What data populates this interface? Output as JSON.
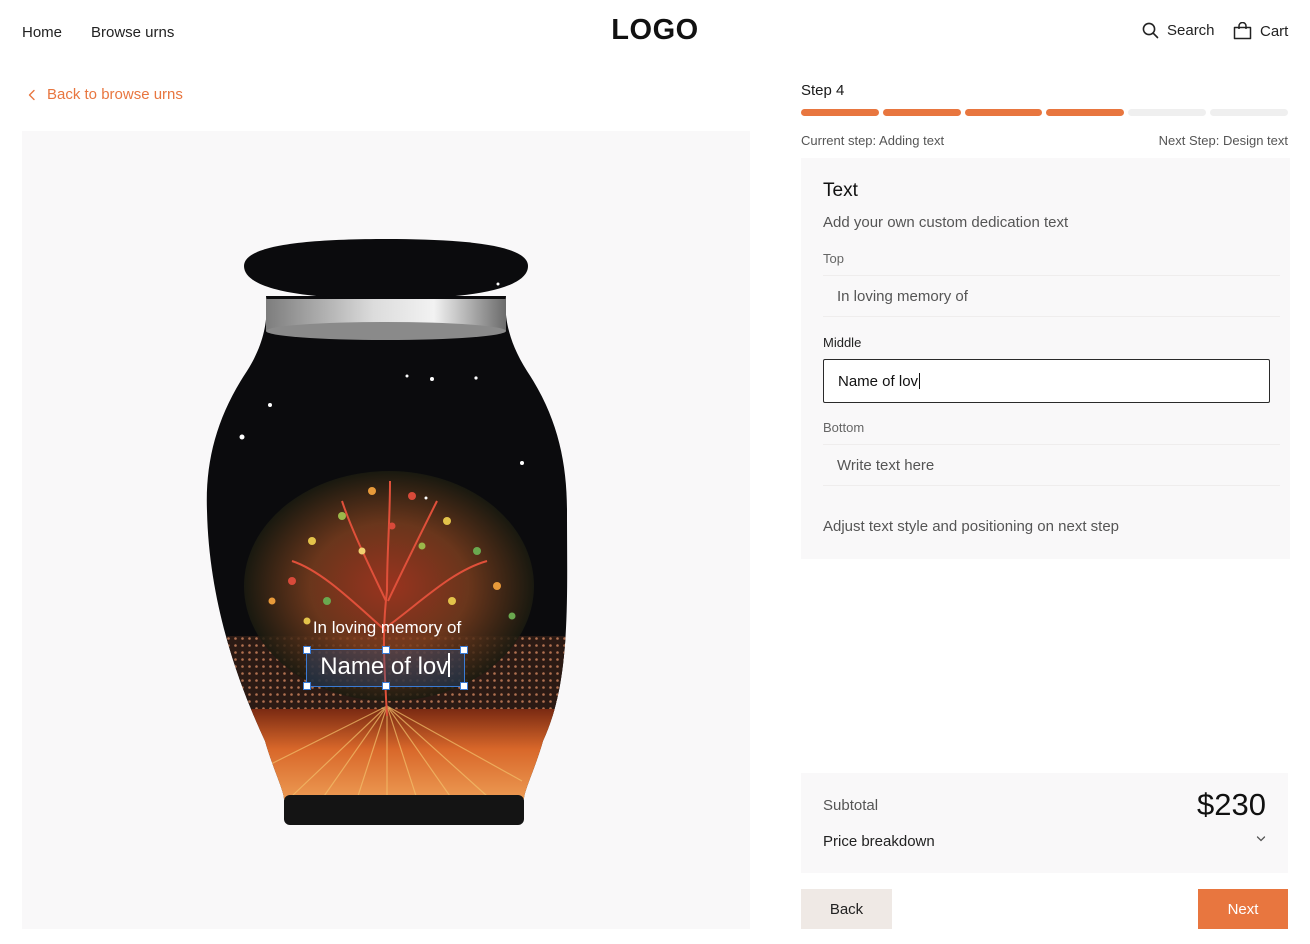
{
  "header": {
    "nav": [
      "Home",
      "Browse urns"
    ],
    "logo": "LOGO",
    "search_label": "Search",
    "search_icon": "search-icon",
    "cart_label": "Cart",
    "cart_icon": "shopping-bag-icon"
  },
  "back_link": {
    "label": "Back to browse urns",
    "icon": "chevron-left-icon"
  },
  "preview": {
    "top_text": "In loving memory of",
    "middle_text": "Name of lov"
  },
  "steps": {
    "label": "Step 4",
    "completed": 4,
    "total": 6,
    "current": "Current step: Adding text",
    "next": "Next Step: Design text"
  },
  "form": {
    "title": "Text",
    "subtitle": "Add your own custom dedication text",
    "top_label": "Top",
    "top_value": "In loving memory of",
    "middle_label": "Middle",
    "middle_value": "Name of lov",
    "bottom_label": "Bottom",
    "bottom_placeholder": "Write text here",
    "note": "Adjust text style and positioning on next step"
  },
  "summary": {
    "subtotal_label": "Subtotal",
    "subtotal_value": "$230",
    "breakdown_label": "Price breakdown",
    "breakdown_icon": "chevron-down-icon"
  },
  "buttons": {
    "back": "Back",
    "next": "Next"
  },
  "colors": {
    "accent": "#e8763f",
    "panel": "#f9f8f9",
    "urn_body": "#0b0b0d",
    "selection": "#3a7bd5"
  }
}
